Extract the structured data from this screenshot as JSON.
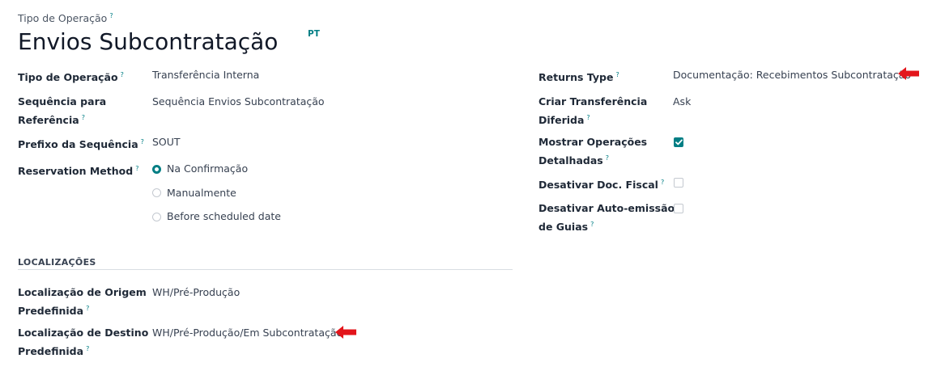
{
  "header": {
    "subtitle": "Tipo de Operação",
    "title": "Envios Subcontratação",
    "lang": "PT"
  },
  "tooltip_mark": "?",
  "left": {
    "operation_type": {
      "label": "Tipo de Operação",
      "value": "Transferência Interna"
    },
    "sequence": {
      "label_line1": "Sequência para",
      "label_line2": "Referência",
      "value": "Sequência Envios Subcontratação"
    },
    "prefix": {
      "label": "Prefixo da Sequência",
      "value": "SOUT"
    },
    "reservation": {
      "label": "Reservation Method",
      "options": [
        "Na Confirmação",
        "Manualmente",
        "Before scheduled date"
      ],
      "selected_index": 0
    }
  },
  "locations": {
    "section_title": "LOCALIZAÇÕES",
    "source": {
      "label_line1": "Localização de Origem",
      "label_line2": "Predefinida",
      "value": "WH/Pré-Produção"
    },
    "dest": {
      "label_line1": "Localização de Destino",
      "label_line2": "Predefinida",
      "value": "WH/Pré-Produção/Em Subcontratação"
    }
  },
  "right": {
    "returns": {
      "label": "Returns Type",
      "value": "Documentação: Recebimentos Subcontratação"
    },
    "backorder": {
      "label_line1": "Criar Transferência",
      "label_line2": "Diferida",
      "value": "Ask"
    },
    "detailed": {
      "label_line1": "Mostrar Operações",
      "label_line2": "Detalhadas",
      "checked": true
    },
    "fiscal": {
      "label": "Desativar Doc. Fiscal",
      "checked": false
    },
    "guides": {
      "label_line1": "Desativar Auto-emissão",
      "label_line2": "de Guias",
      "checked": false
    }
  },
  "colors": {
    "accent": "#017e84",
    "annotation_arrow": "#e3151b"
  }
}
